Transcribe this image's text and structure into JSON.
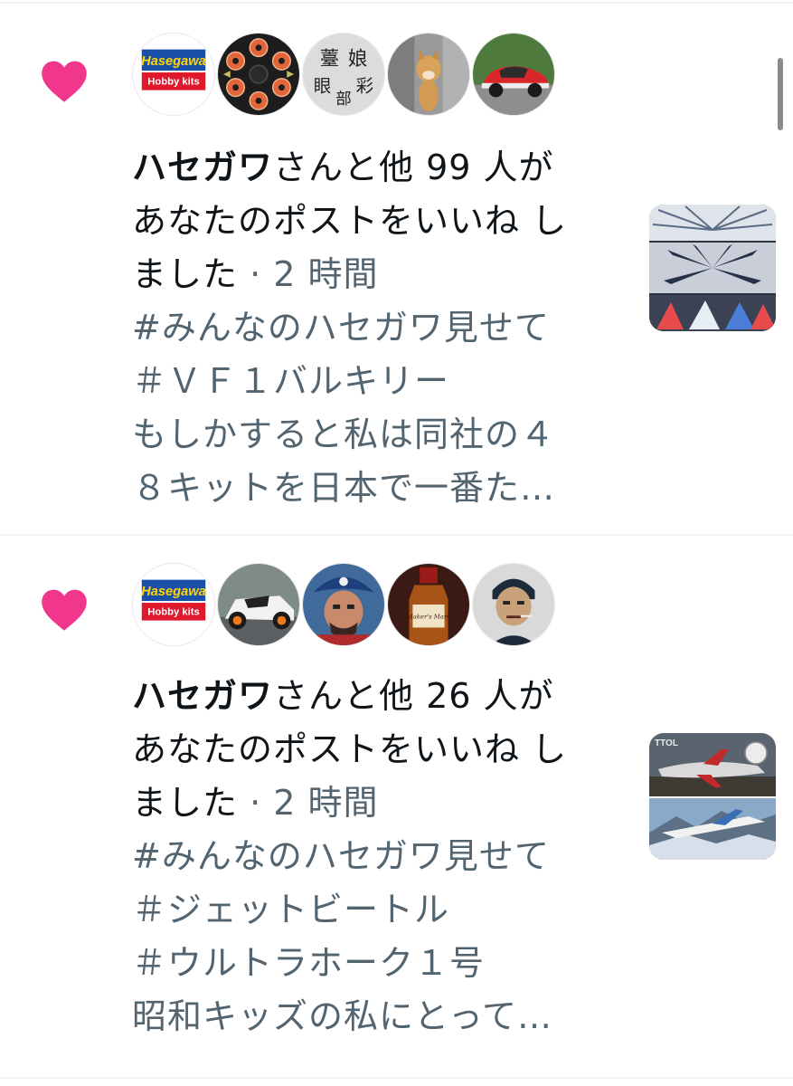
{
  "colors": {
    "heart": "#f0378c",
    "text": "#0f1419",
    "secondary": "#536471",
    "divider": "#eff3f4"
  },
  "notifications": [
    {
      "icon": "heart-icon",
      "avatars": [
        "hasegawa-hobby-kits-logo",
        "orange-gear-pattern",
        "calligraphy-stamp",
        "shiba-dog-photo",
        "red-car-photo"
      ],
      "actor": "ハセガワ",
      "line1_rest": "さんと他 99 人が",
      "line2": "あなたのポストをいいね し",
      "line3": "ました",
      "separator": "·",
      "time": "2 時間",
      "preview_lines": [
        "#みんなのハセガワ見せて",
        "＃ＶＦ１バルキリー",
        "もしかすると私は同社の４",
        "８キットを日本で一番た…"
      ],
      "thumbnail": "vf1-valkyrie-collage"
    },
    {
      "icon": "heart-icon",
      "avatars": [
        "hasegawa-hobby-kits-logo",
        "race-car-model-photo",
        "pirate-figure-photo",
        "whisky-bottle-photo",
        "caricature-figure-photo"
      ],
      "actor": "ハセガワ",
      "line1_rest": "さんと他 26 人が",
      "line2": "あなたのポストをいいね し",
      "line3": "ました",
      "separator": "·",
      "time": "2 時間",
      "preview_lines": [
        "#みんなのハセガワ見せて",
        "＃ジェットビートル",
        "＃ウルトラホーク１号",
        "昭和キッズの私にとって…"
      ],
      "thumbnail": "jet-beetle-ultra-hawk-collage"
    }
  ],
  "logo": {
    "brand_text": "Hasegawa",
    "sub_text": "Hobby kits"
  },
  "stamp_text": [
    "薹",
    "娘",
    "眼",
    "部",
    "彩"
  ],
  "bottle_label": "Maker's Mark",
  "plane_label": "TTOL"
}
